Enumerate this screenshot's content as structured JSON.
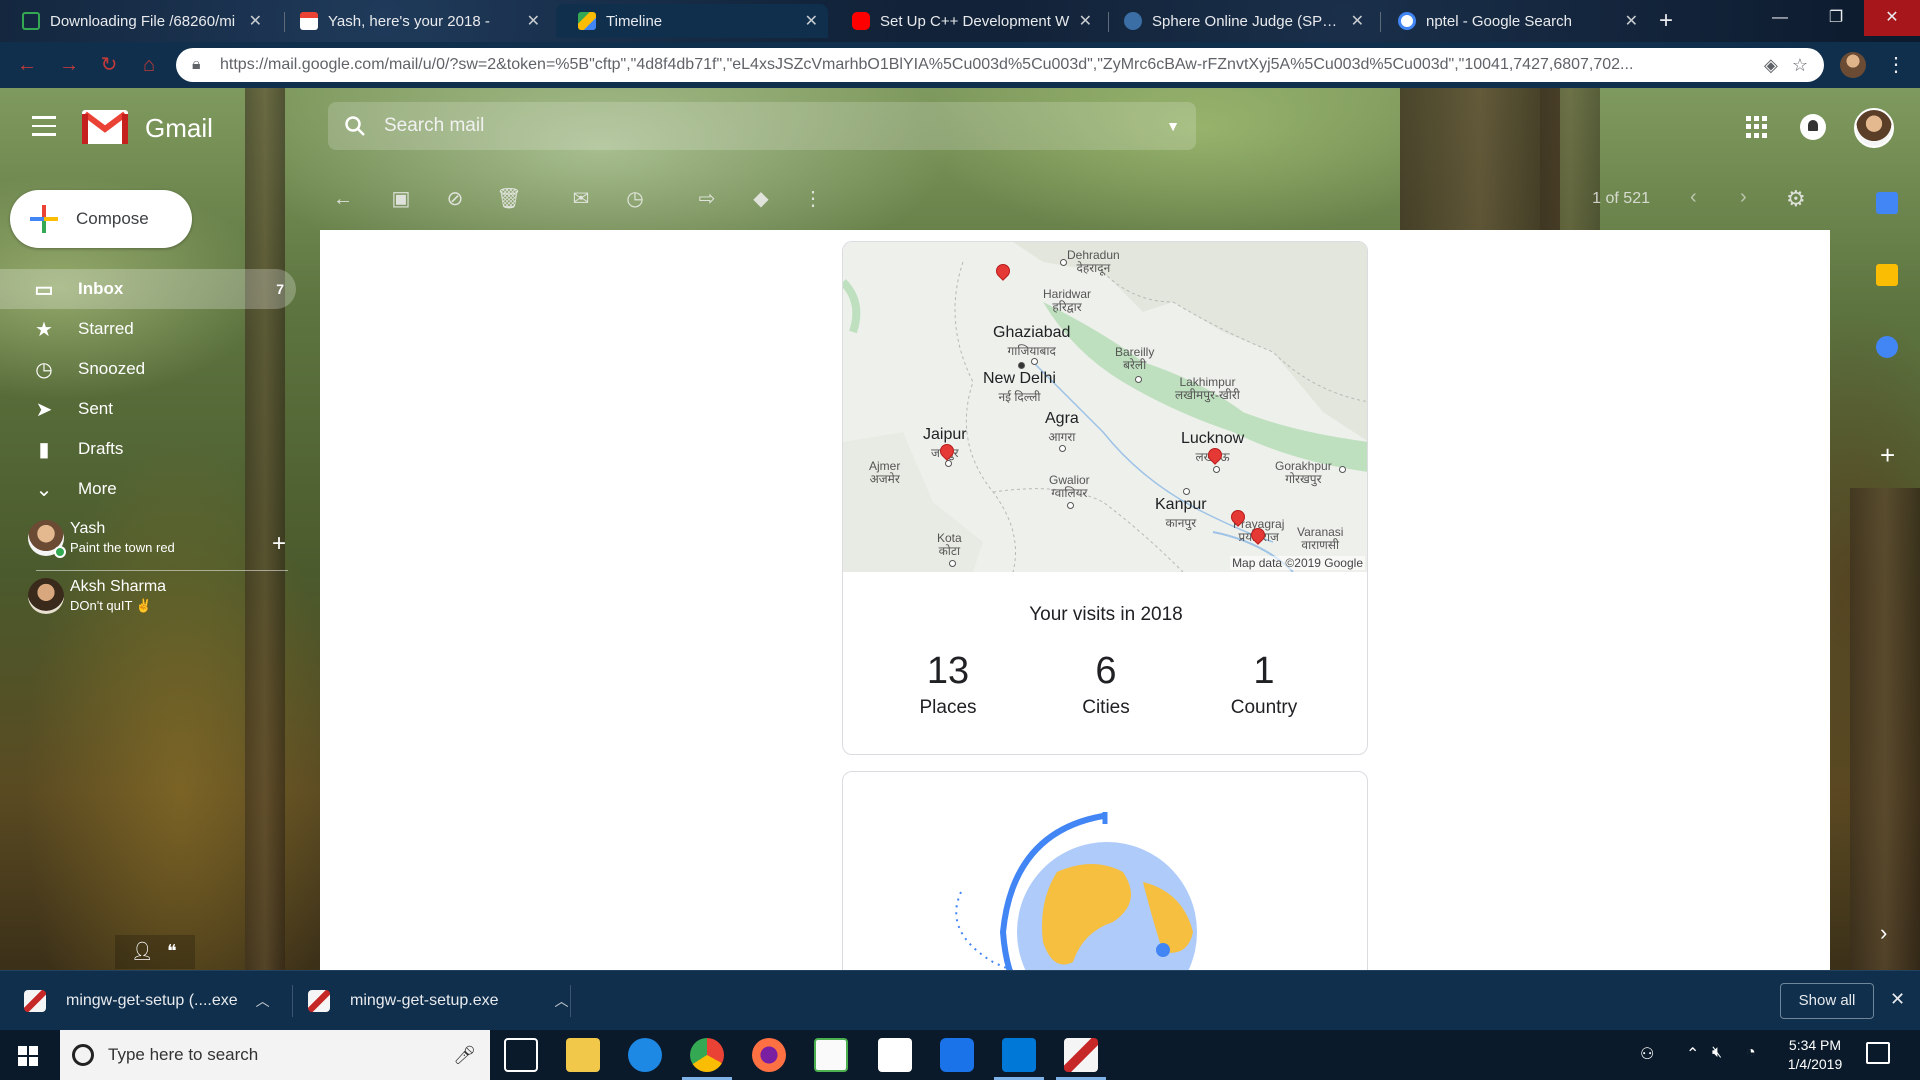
{
  "browser": {
    "tabs": [
      {
        "label": "Downloading File /68260/mi",
        "favicon_color": "#34a853"
      },
      {
        "label": "Yash, here's your 2018 -",
        "favicon_color": "#ea4335"
      },
      {
        "label": "Timeline",
        "favicon_color": "#4285f4"
      },
      {
        "label": "Set Up C++ Development W",
        "favicon_color": "#ff0000"
      },
      {
        "label": "Sphere Online Judge (SPOJ)",
        "favicon_color": "#3b6ea5"
      },
      {
        "label": "nptel - Google Search",
        "favicon_color": "#ffffff"
      }
    ],
    "active_tab_index": 2,
    "url": "https://mail.google.com/mail/u/0/?sw=2&token=%5B\"cftp\",\"4d8f4db71f\",\"eL4xsJSZcVmarhbO1BlYIA%5Cu003d%5Cu003d\",\"ZyMrc6cBAw-rFZnvtXyj5A%5Cu003d%5Cu003d\",\"10041,7427,6807,702..."
  },
  "gmail": {
    "brand": "Gmail",
    "search_placeholder": "Search mail",
    "compose_label": "Compose",
    "pagination": "1 of 521",
    "nav": [
      {
        "label": "Inbox",
        "count": "7",
        "icon": "inbox-icon"
      },
      {
        "label": "Starred",
        "count": "",
        "icon": "star-icon"
      },
      {
        "label": "Snoozed",
        "count": "",
        "icon": "clock-icon"
      },
      {
        "label": "Sent",
        "count": "",
        "icon": "send-icon"
      },
      {
        "label": "Drafts",
        "count": "",
        "icon": "draft-icon"
      },
      {
        "label": "More",
        "count": "",
        "icon": "chevron-down-icon"
      }
    ],
    "hangouts": [
      {
        "name": "Yash",
        "status": "Paint the town red"
      },
      {
        "name": "Aksh Sharma",
        "status": "DOn't quIT ✌"
      }
    ]
  },
  "email": {
    "map_cities": [
      {
        "en": "Dehradun",
        "hi": "देहरादून",
        "size": "small"
      },
      {
        "en": "Haridwar",
        "hi": "हरिद्वार",
        "size": "small"
      },
      {
        "en": "Ghaziabad",
        "hi": "गाजियाबाद",
        "size": "big"
      },
      {
        "en": "New Delhi",
        "hi": "नई दिल्ली",
        "size": "big"
      },
      {
        "en": "Bareilly",
        "hi": "बरेली",
        "size": "small"
      },
      {
        "en": "Lakhimpur",
        "hi": "लखीमपुर-खीरी",
        "size": "small"
      },
      {
        "en": "Jaipur",
        "hi": "जयपुर",
        "size": "big"
      },
      {
        "en": "Agra",
        "hi": "आगरा",
        "size": "big"
      },
      {
        "en": "Lucknow",
        "hi": "लखनऊ",
        "size": "big"
      },
      {
        "en": "Ajmer",
        "hi": "अजमेर",
        "size": "small"
      },
      {
        "en": "Gwalior",
        "hi": "ग्वालियर",
        "size": "small"
      },
      {
        "en": "Gorakhpur",
        "hi": "गोरखपुर",
        "size": "small"
      },
      {
        "en": "Kanpur",
        "hi": "कानपुर",
        "size": "big"
      },
      {
        "en": "Prayagraj",
        "hi": "प्रयागराज",
        "size": "small"
      },
      {
        "en": "Varanasi",
        "hi": "वाराणसी",
        "size": "small"
      },
      {
        "en": "Kota",
        "hi": "कोटा",
        "size": "small"
      }
    ],
    "map_credit": "Map data ©2019 Google",
    "visits_title": "Your visits in 2018",
    "stats": [
      {
        "value": "13",
        "label": "Places"
      },
      {
        "value": "6",
        "label": "Cities"
      },
      {
        "value": "1",
        "label": "Country"
      }
    ]
  },
  "downloads": {
    "items": [
      {
        "label": "mingw-get-setup (....exe"
      },
      {
        "label": "mingw-get-setup.exe"
      }
    ],
    "show_all": "Show all"
  },
  "taskbar": {
    "search_placeholder": "Type here to search",
    "time": "5:34 PM",
    "date": "1/4/2019"
  }
}
